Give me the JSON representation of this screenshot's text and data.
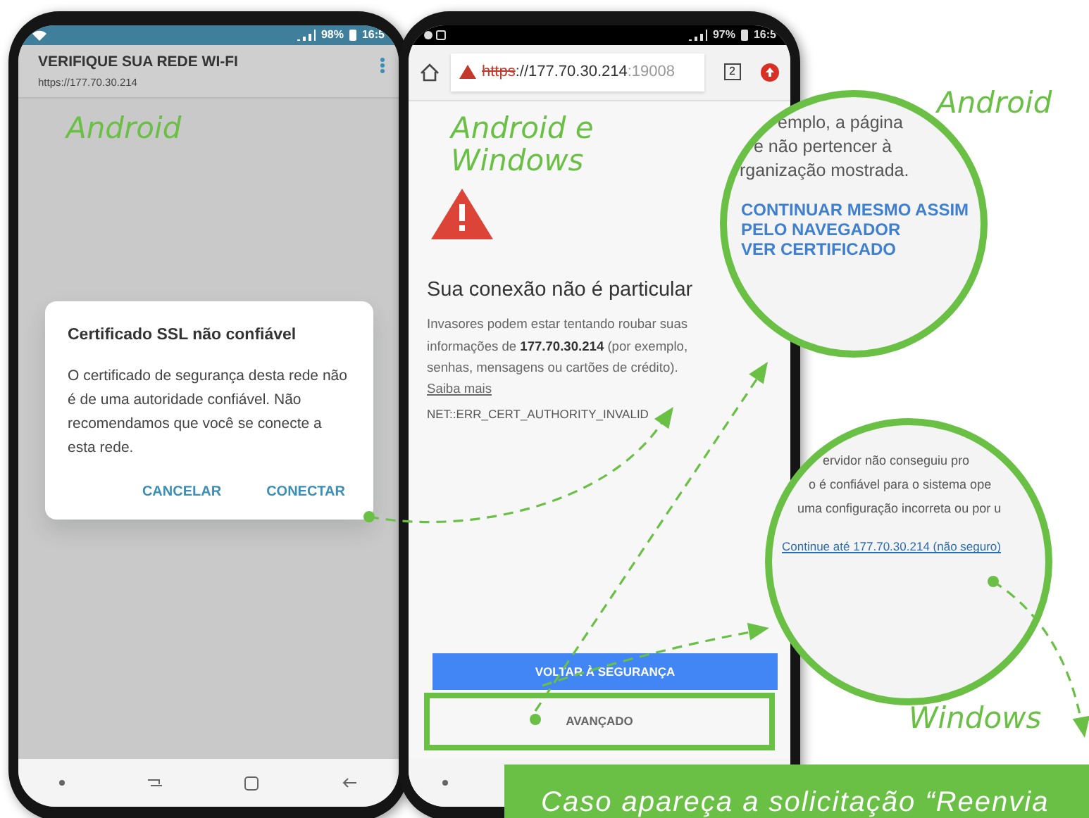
{
  "android_phone": {
    "status_bar": {
      "battery": "98%",
      "time": "16:5"
    },
    "app_bar": {
      "title": "VERIFIQUE SUA REDE WI-FI",
      "url": "https://177.70.30.214"
    },
    "dialog": {
      "title": "Certificado SSL não confiável",
      "message": "O certificado de segurança desta rede não é de uma autoridade confiável. Não recomendamos que você se conecte a esta rede.",
      "buttons": [
        "CANCELAR",
        "CONECTAR"
      ]
    }
  },
  "browser_phone": {
    "status_bar": {
      "battery": "97%",
      "time": "16:5"
    },
    "address_bar": {
      "scheme": "https",
      "host": "://177.70.30.214",
      "port": ":19008",
      "tab_count": "2"
    },
    "heading": "Sua conexão não é particular",
    "message": "Invasores podem estar tentando roubar suas informações de **177.70.30.214** (por exemplo, senhas, mensagens ou cartões de crédito).",
    "learn_more_link": "Saiba mais",
    "error_code": "NET::ERR_CERT_AUTHORITY_INVALID",
    "buttons": [
      {
        "label": "VOLTAR À SEGURANÇA",
        "kind": "primary",
        "highlighted": false
      },
      {
        "label": "AVANÇADO",
        "kind": "secondary",
        "highlighted": true
      }
    ]
  },
  "zoom_android": {
    "text_lines": [
      "emplo, a página",
      "e não pertencer à",
      "rganização mostrada."
    ],
    "links": [
      "CONTINUAR MESMO ASSIM",
      "PELO NAVEGADOR",
      "VER CERTIFICADO"
    ]
  },
  "zoom_windows": {
    "text_lines": [
      "ervidor não conseguiu pro",
      "o é confiável para o sistema ope",
      "uma configuração incorreta ou por u"
    ],
    "link": "Continue até 177.70.30.214 (não seguro)"
  },
  "labels": {
    "android": "Android",
    "android_windows": "Android e Windows",
    "android_zoom": "Android",
    "windows_zoom": "Windows"
  },
  "caption": "Caso apareça a solicitação “Reenvia"
}
